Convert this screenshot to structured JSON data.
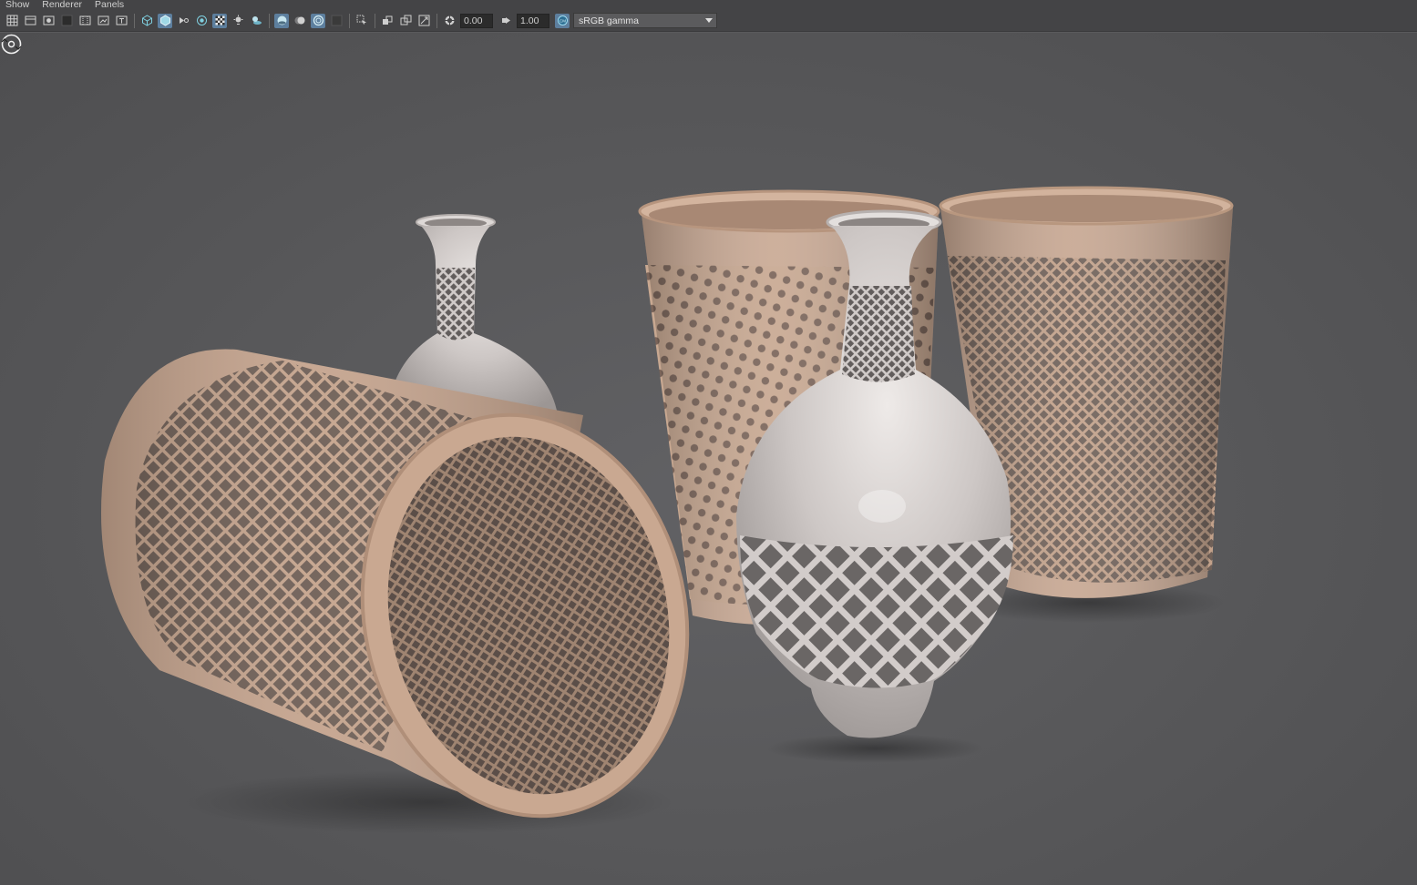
{
  "menu": {
    "items": [
      "Show",
      "Renderer",
      "Panels"
    ]
  },
  "toolbar": {
    "exposure_value": "0.00",
    "gamma_value": "1.00",
    "color_space": "sRGB gamma",
    "icons": [
      "grid-icon",
      "camera-attributes-icon",
      "image-plane-icon",
      "bookmark-icon",
      "film-gate-icon",
      "resolution-gate-icon",
      "safe-title-icon",
      "wireframe-icon",
      "smooth-shade-icon",
      "default-material-icon",
      "xray-icon",
      "textured-icon",
      "lights-icon",
      "shadows-icon",
      "ambient-occlusion-icon",
      "motion-blur-icon",
      "anti-aliasing-icon",
      "depth-of-field-icon",
      "isolate-select-icon",
      "xray-joints-icon",
      "xray-active-icon",
      "backface-icon",
      "exposure-icon",
      "gamma-icon",
      "color-management-icon"
    ]
  },
  "colors": {
    "panel": "#444446",
    "viewport_bg": "#59595b",
    "basket_tan": "#c6a690",
    "vase_grey": "#cfc9c6",
    "active_icon": "#5d7f9e"
  },
  "viewport": {
    "objects": [
      "lying-basket",
      "small-vase",
      "back-basket-left",
      "back-basket-right",
      "front-vase"
    ]
  }
}
